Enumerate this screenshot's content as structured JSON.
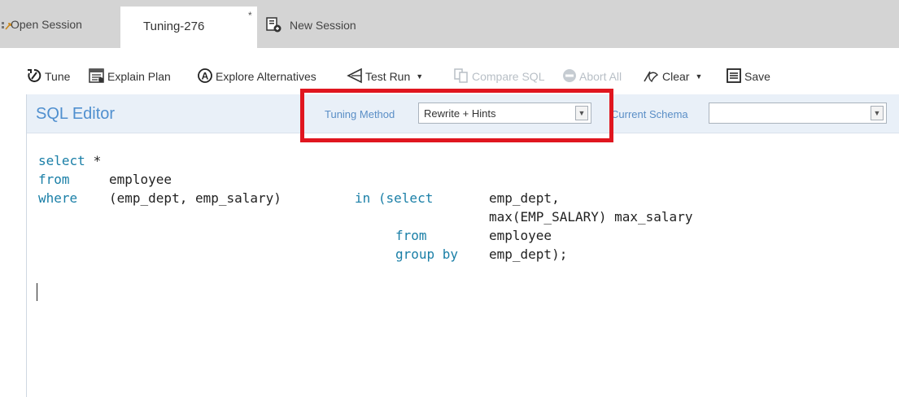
{
  "tabs": [
    {
      "label": "Open Session",
      "icon": "open-session-icon"
    },
    {
      "label": "Tuning-276",
      "modified_marker": "*",
      "active": true
    },
    {
      "label": "New Session",
      "icon": "new-session-icon"
    }
  ],
  "toolbar": {
    "tune": "Tune",
    "explain_plan": "Explain Plan",
    "explore_alternatives": "Explore Alternatives",
    "test_run": "Test Run",
    "compare_sql": "Compare SQL",
    "abort_all": "Abort All",
    "clear": "Clear",
    "save": "Save",
    "disabled_items": [
      "Compare SQL",
      "Abort All"
    ]
  },
  "editor": {
    "title": "SQL Editor",
    "tuning_method_label": "Tuning Method",
    "tuning_method_value": "Rewrite + Hints",
    "current_schema_label": "Current Schema",
    "current_schema_value": ""
  },
  "sql": {
    "line1": {
      "kw": "select",
      "rest": " *"
    },
    "line2": {
      "kw": "from",
      "rest": "employee"
    },
    "line3": {
      "kw1": "where",
      "text1": "(emp_dept, emp_salary)",
      "kw2": "in (select",
      "text2": "emp_dept,"
    },
    "line4": {
      "text": "max(EMP_SALARY) max_salary"
    },
    "line5": {
      "kw": "from",
      "text": "employee"
    },
    "line6": {
      "kw": "group by",
      "text": "emp_dept);"
    }
  },
  "colors": {
    "keyword": "#1a7fa7",
    "header_bg": "#e9f0f8",
    "title": "#4f8fcf",
    "highlight_box": "#e0161f",
    "tab_strip": "#d4d4d4"
  }
}
